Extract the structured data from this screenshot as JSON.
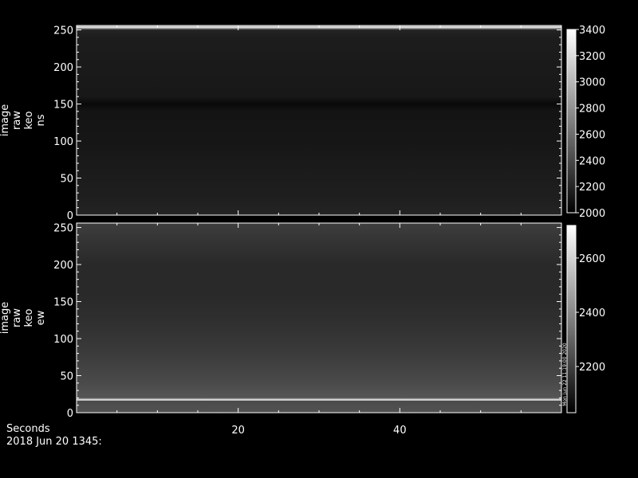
{
  "footer": {
    "seconds_label": "Seconds",
    "date_label": "2018 Jun 20 1345:"
  },
  "side_note": "Mon Jun 22 11:19:00 2020",
  "colors": {
    "background": "#000000",
    "axes": "#ffffff",
    "bright_row": "#f2f2f2"
  },
  "chart_data": [
    {
      "type": "heatmap",
      "title": "",
      "ylabel_lines": [
        "image",
        "raw",
        "keo",
        "ns"
      ],
      "xlabel": "",
      "ylim": [
        0,
        256
      ],
      "yticks": [
        0,
        50,
        100,
        150,
        200,
        250
      ],
      "xticks": [
        20,
        40
      ],
      "xlim": [
        0,
        60
      ],
      "colorbar": {
        "range": [
          2000,
          3400
        ],
        "ticks": [
          2000,
          2200,
          2400,
          2600,
          2800,
          3000,
          3200,
          3400
        ]
      },
      "approx_row_values": {
        "rows": [
          0,
          20,
          60,
          100,
          140,
          150,
          160,
          200,
          240,
          250,
          254,
          256
        ],
        "values": [
          2200,
          2170,
          2150,
          2120,
          2110,
          2050,
          2130,
          2140,
          2160,
          2200,
          3400,
          2200
        ]
      },
      "features": [
        "bright horizontal line near row 255",
        "dark horizontal band near row 152"
      ]
    },
    {
      "type": "heatmap",
      "title": "",
      "ylabel_lines": [
        "image",
        "raw",
        "keo",
        "ew"
      ],
      "xlabel": "",
      "ylim": [
        0,
        256
      ],
      "yticks": [
        0,
        50,
        100,
        150,
        200,
        250
      ],
      "xticks": [
        20,
        40
      ],
      "xlim": [
        0,
        60
      ],
      "colorbar": {
        "range": [
          2030,
          2720
        ],
        "ticks": [
          2200,
          2400,
          2600
        ]
      },
      "approx_row_values": {
        "rows": [
          0,
          10,
          16,
          17,
          20,
          40,
          80,
          120,
          160,
          200,
          240,
          256
        ],
        "values": [
          2250,
          2240,
          2230,
          2720,
          2260,
          2230,
          2190,
          2160,
          2140,
          2140,
          2180,
          2200
        ]
      },
      "features": [
        "bright horizontal line near row 17",
        "brighter region below row 17"
      ]
    }
  ]
}
